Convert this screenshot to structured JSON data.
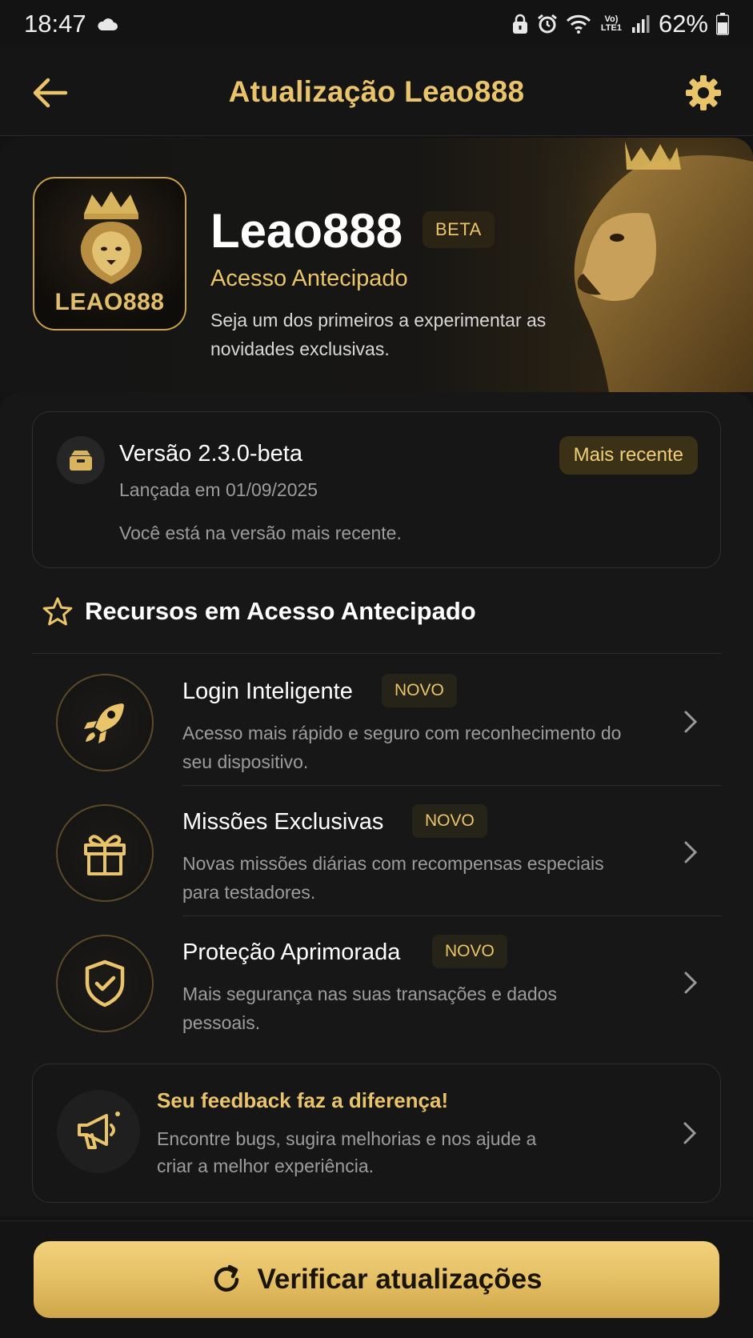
{
  "status_bar": {
    "time": "18:47",
    "battery": "62%",
    "network": "Vo) LTE1"
  },
  "app_bar": {
    "title": "Atualização Leao888"
  },
  "hero": {
    "icon_wordmark": "LEAO888",
    "name": "Leao888",
    "badge": "BETA",
    "subtitle": "Acesso Antecipado",
    "description": "Seja um dos primeiros a experimentar as novidades exclusivas."
  },
  "version": {
    "title": "Versão 2.3.0-beta",
    "released": "Lançada em 01/09/2025",
    "status": "Você está na versão mais recente.",
    "badge": "Mais recente"
  },
  "features_section": {
    "title": "Recursos em Acesso Antecipado",
    "items": [
      {
        "title": "Login Inteligente",
        "badge": "NOVO",
        "description": "Acesso mais rápido e seguro com reconhecimento do seu dispositivo.",
        "icon": "rocket-icon"
      },
      {
        "title": "Missões Exclusivas",
        "badge": "NOVO",
        "description": "Novas missões diárias com recompensas especiais para testadores.",
        "icon": "gift-icon"
      },
      {
        "title": "Proteção Aprimorada",
        "badge": "NOVO",
        "description": "Mais segurança nas suas transações e dados pessoais.",
        "icon": "shield-check-icon"
      }
    ]
  },
  "feedback": {
    "title": "Seu feedback faz a diferença!",
    "description": "Encontre bugs, sugira melhorias e nos ajude a criar a melhor experiência."
  },
  "actions": {
    "check_updates": "Verificar atualizações"
  },
  "colors": {
    "accent": "#e9c46a",
    "background": "#131313",
    "card_border": "#2f2f2f"
  }
}
